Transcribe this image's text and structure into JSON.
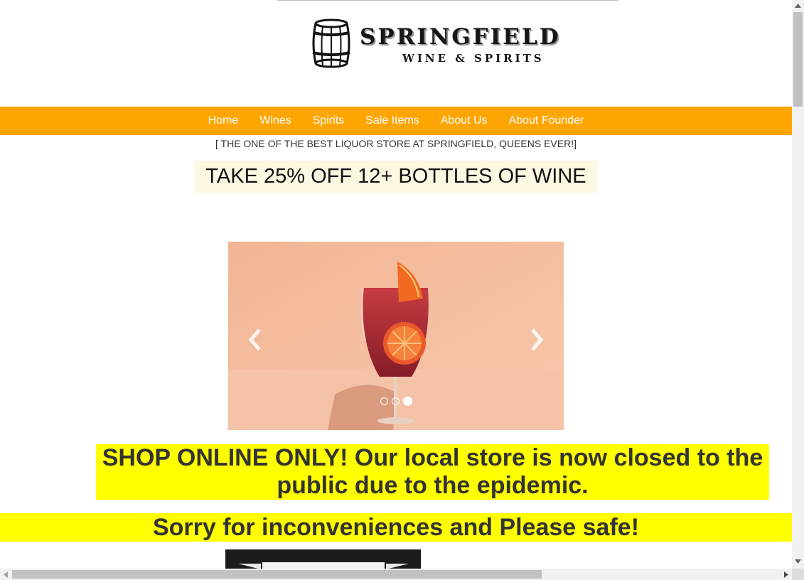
{
  "brand": {
    "name": "SPRINGFIELD",
    "subtitle": "WINE & SPIRITS"
  },
  "nav": {
    "items": [
      {
        "label": "Home"
      },
      {
        "label": "Wines"
      },
      {
        "label": "Spirits"
      },
      {
        "label": "Sale Items"
      },
      {
        "label": "About Us"
      },
      {
        "label": "About Founder"
      }
    ]
  },
  "tagline": "[ THE ONE OF THE BEST LIQUOR STORE AT SPRINGFIELD, QUEENS EVER!]",
  "promo": "TAKE 25% OFF 12+ BOTTLES OF WINE",
  "carousel": {
    "slide_count": 3,
    "active_index": 2
  },
  "notice": "SHOP ONLINE ONLY! Our local store is now closed to the public due to the epidemic.",
  "sorry": "Sorry for inconveniences and Please safe!",
  "colors": {
    "nav_background": "#ffa500",
    "highlight_background": "#ffff00",
    "promo_background": "#fdf8e2"
  },
  "icons": {
    "logo": "barrel-icon",
    "prev": "chevron-left-icon",
    "next": "chevron-right-icon"
  }
}
